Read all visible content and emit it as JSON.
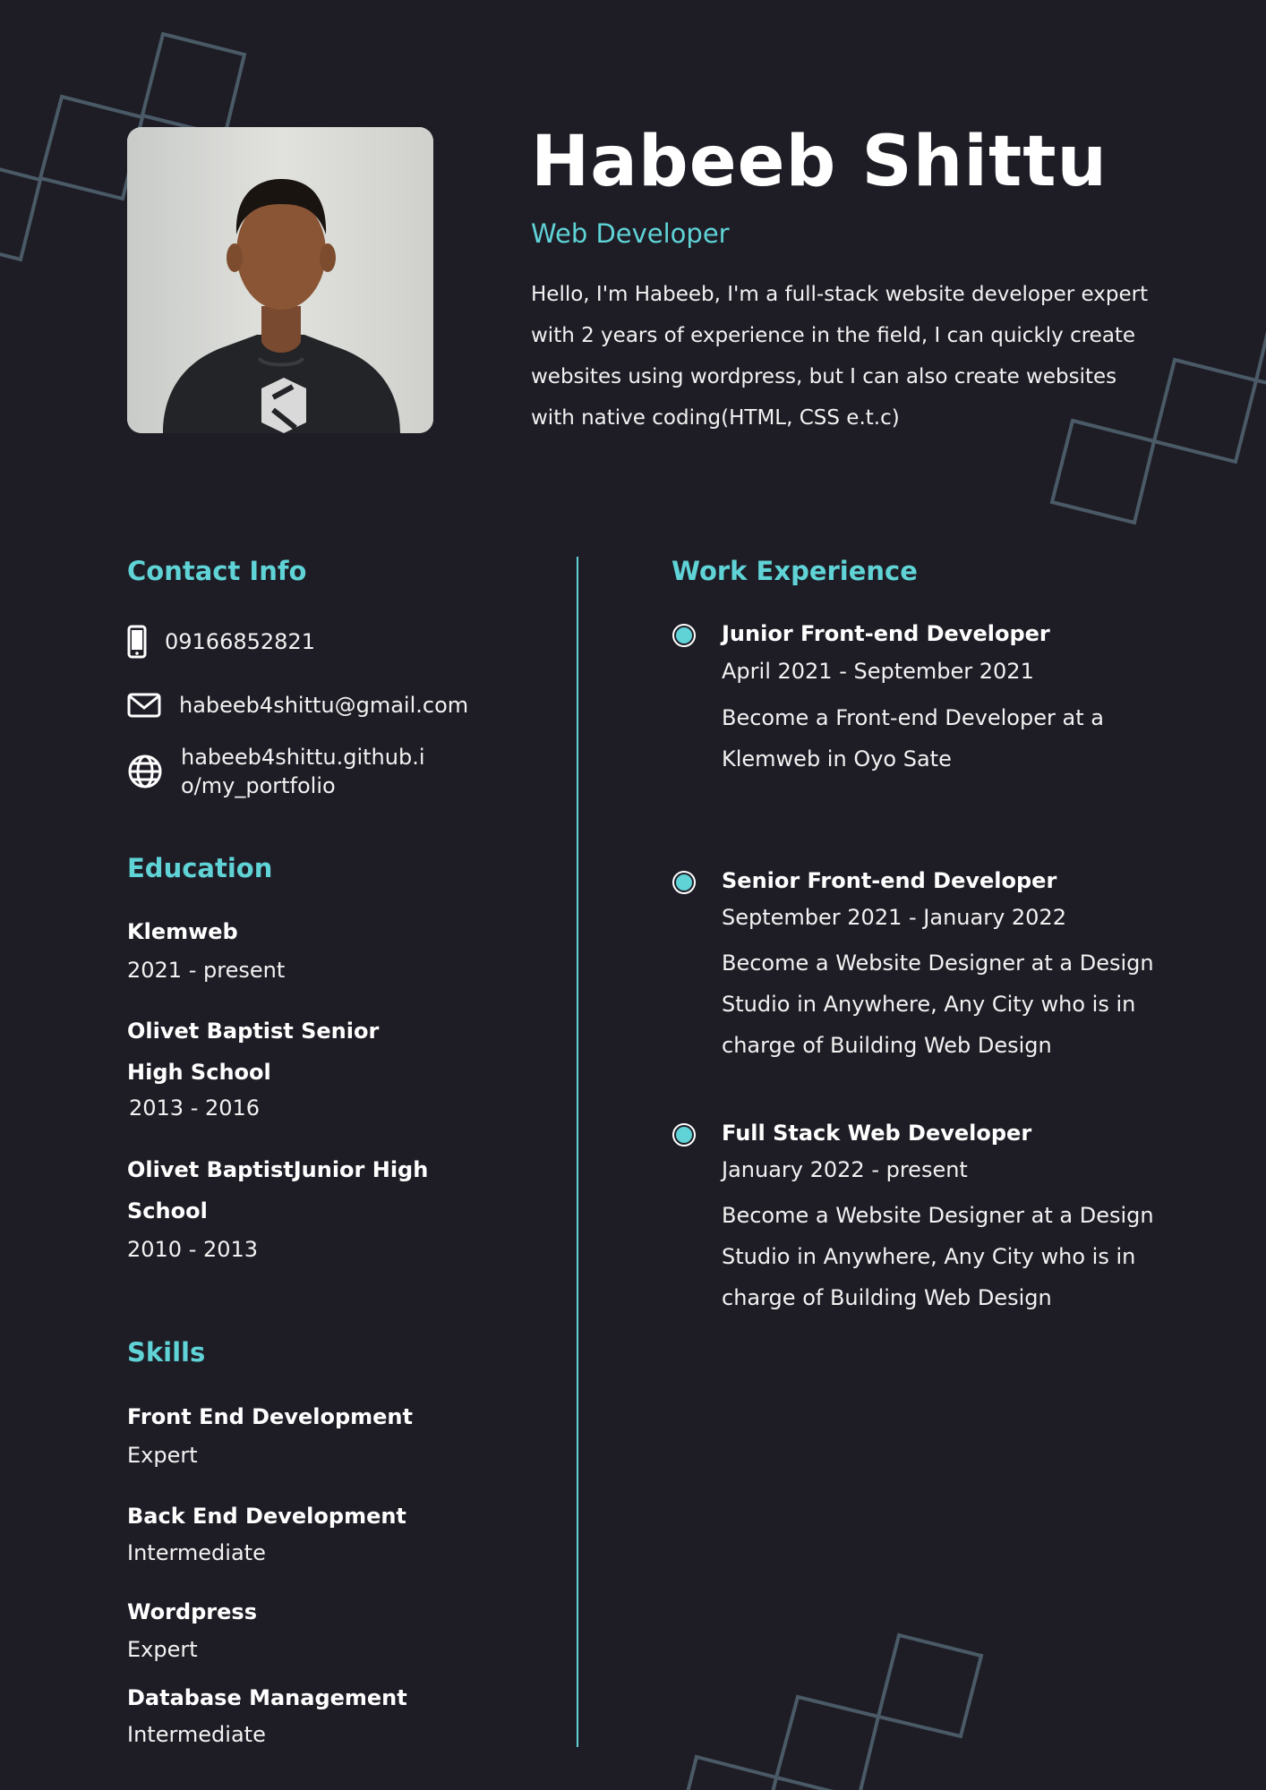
{
  "header": {
    "name": "Habeeb Shittu",
    "role": "Web Developer",
    "bio": "Hello, I'm Habeeb, I'm a full-stack website developer expert with 2 years of experience in the field, I can quickly create websites using wordpress, but I can also create websites with native coding(HTML, CSS e.t.c)"
  },
  "contact": {
    "title": "Contact Info",
    "phone": "09166852821",
    "email": "habeeb4shittu@gmail.com",
    "website_line1": "habeeb4shittu.github.i",
    "website_line2": "o/my_portfolio"
  },
  "education": {
    "title": "Education",
    "items": [
      {
        "school": "Klemweb",
        "years": "2021 - present"
      },
      {
        "school": "Olivet Baptist Senior High School",
        "years": "2013 - 2016"
      },
      {
        "school": "Olivet BaptistJunior High School",
        "years": "2010 - 2013"
      }
    ]
  },
  "skills": {
    "title": "Skills",
    "items": [
      {
        "name": "Front End Development",
        "level": "Expert"
      },
      {
        "name": "Back End Development",
        "level": "Intermediate"
      },
      {
        "name": "Wordpress",
        "level": "Expert"
      },
      {
        "name": "Database Management",
        "level": "Intermediate"
      }
    ]
  },
  "experience": {
    "title": "Work Experience",
    "items": [
      {
        "title": "Junior Front-end Developer",
        "dates": "April 2021 - September 2021",
        "desc": "Become a Front-end Developer at a Klemweb in Oyo Sate"
      },
      {
        "title": "Senior Front-end Developer",
        "dates": "September 2021 - January 2022",
        "desc": "Become a Website Designer at a Design Studio in Anywhere, Any City who is in charge of Building Web Design"
      },
      {
        "title": "Full Stack Web Developer",
        "dates": "January 2022 - present",
        "desc": "Become a Website Designer at a Design Studio in Anywhere, Any City who is in charge of Building Web Design"
      }
    ]
  },
  "colors": {
    "background": "#1e1d26",
    "accent": "#5fd3d6",
    "decoration": "#4a5a66"
  }
}
